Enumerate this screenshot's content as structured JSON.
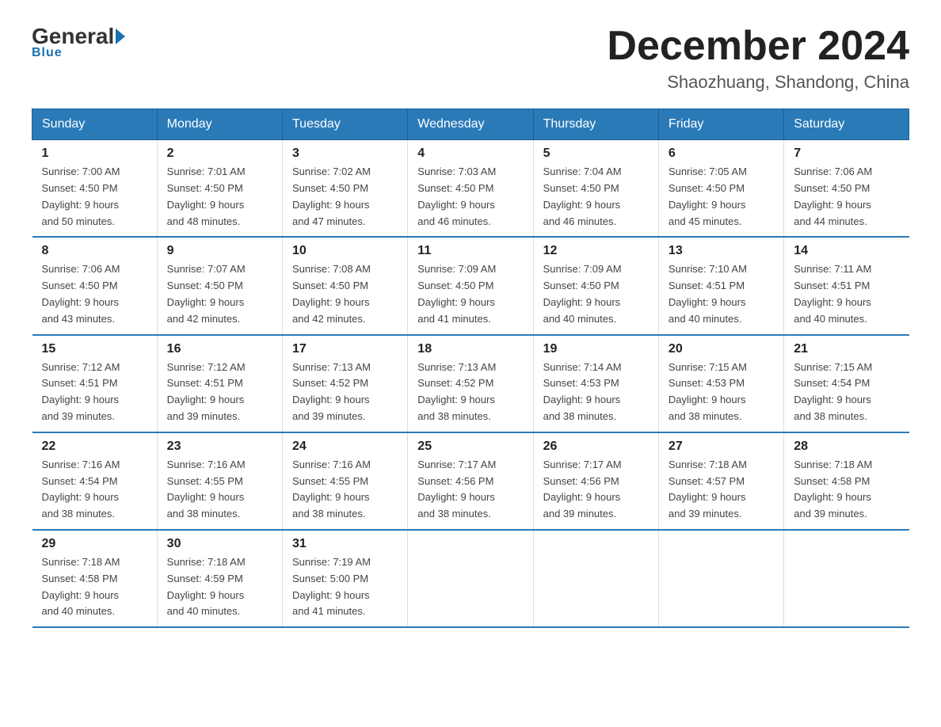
{
  "logo": {
    "general": "General",
    "blue_text": "Blue",
    "underline": "Blue"
  },
  "title": {
    "month_year": "December 2024",
    "location": "Shaozhuang, Shandong, China"
  },
  "days_of_week": [
    "Sunday",
    "Monday",
    "Tuesday",
    "Wednesday",
    "Thursday",
    "Friday",
    "Saturday"
  ],
  "weeks": [
    [
      {
        "day": "1",
        "sunrise": "7:00 AM",
        "sunset": "4:50 PM",
        "daylight": "9 hours and 50 minutes."
      },
      {
        "day": "2",
        "sunrise": "7:01 AM",
        "sunset": "4:50 PM",
        "daylight": "9 hours and 48 minutes."
      },
      {
        "day": "3",
        "sunrise": "7:02 AM",
        "sunset": "4:50 PM",
        "daylight": "9 hours and 47 minutes."
      },
      {
        "day": "4",
        "sunrise": "7:03 AM",
        "sunset": "4:50 PM",
        "daylight": "9 hours and 46 minutes."
      },
      {
        "day": "5",
        "sunrise": "7:04 AM",
        "sunset": "4:50 PM",
        "daylight": "9 hours and 46 minutes."
      },
      {
        "day": "6",
        "sunrise": "7:05 AM",
        "sunset": "4:50 PM",
        "daylight": "9 hours and 45 minutes."
      },
      {
        "day": "7",
        "sunrise": "7:06 AM",
        "sunset": "4:50 PM",
        "daylight": "9 hours and 44 minutes."
      }
    ],
    [
      {
        "day": "8",
        "sunrise": "7:06 AM",
        "sunset": "4:50 PM",
        "daylight": "9 hours and 43 minutes."
      },
      {
        "day": "9",
        "sunrise": "7:07 AM",
        "sunset": "4:50 PM",
        "daylight": "9 hours and 42 minutes."
      },
      {
        "day": "10",
        "sunrise": "7:08 AM",
        "sunset": "4:50 PM",
        "daylight": "9 hours and 42 minutes."
      },
      {
        "day": "11",
        "sunrise": "7:09 AM",
        "sunset": "4:50 PM",
        "daylight": "9 hours and 41 minutes."
      },
      {
        "day": "12",
        "sunrise": "7:09 AM",
        "sunset": "4:50 PM",
        "daylight": "9 hours and 40 minutes."
      },
      {
        "day": "13",
        "sunrise": "7:10 AM",
        "sunset": "4:51 PM",
        "daylight": "9 hours and 40 minutes."
      },
      {
        "day": "14",
        "sunrise": "7:11 AM",
        "sunset": "4:51 PM",
        "daylight": "9 hours and 40 minutes."
      }
    ],
    [
      {
        "day": "15",
        "sunrise": "7:12 AM",
        "sunset": "4:51 PM",
        "daylight": "9 hours and 39 minutes."
      },
      {
        "day": "16",
        "sunrise": "7:12 AM",
        "sunset": "4:51 PM",
        "daylight": "9 hours and 39 minutes."
      },
      {
        "day": "17",
        "sunrise": "7:13 AM",
        "sunset": "4:52 PM",
        "daylight": "9 hours and 39 minutes."
      },
      {
        "day": "18",
        "sunrise": "7:13 AM",
        "sunset": "4:52 PM",
        "daylight": "9 hours and 38 minutes."
      },
      {
        "day": "19",
        "sunrise": "7:14 AM",
        "sunset": "4:53 PM",
        "daylight": "9 hours and 38 minutes."
      },
      {
        "day": "20",
        "sunrise": "7:15 AM",
        "sunset": "4:53 PM",
        "daylight": "9 hours and 38 minutes."
      },
      {
        "day": "21",
        "sunrise": "7:15 AM",
        "sunset": "4:54 PM",
        "daylight": "9 hours and 38 minutes."
      }
    ],
    [
      {
        "day": "22",
        "sunrise": "7:16 AM",
        "sunset": "4:54 PM",
        "daylight": "9 hours and 38 minutes."
      },
      {
        "day": "23",
        "sunrise": "7:16 AM",
        "sunset": "4:55 PM",
        "daylight": "9 hours and 38 minutes."
      },
      {
        "day": "24",
        "sunrise": "7:16 AM",
        "sunset": "4:55 PM",
        "daylight": "9 hours and 38 minutes."
      },
      {
        "day": "25",
        "sunrise": "7:17 AM",
        "sunset": "4:56 PM",
        "daylight": "9 hours and 38 minutes."
      },
      {
        "day": "26",
        "sunrise": "7:17 AM",
        "sunset": "4:56 PM",
        "daylight": "9 hours and 39 minutes."
      },
      {
        "day": "27",
        "sunrise": "7:18 AM",
        "sunset": "4:57 PM",
        "daylight": "9 hours and 39 minutes."
      },
      {
        "day": "28",
        "sunrise": "7:18 AM",
        "sunset": "4:58 PM",
        "daylight": "9 hours and 39 minutes."
      }
    ],
    [
      {
        "day": "29",
        "sunrise": "7:18 AM",
        "sunset": "4:58 PM",
        "daylight": "9 hours and 40 minutes."
      },
      {
        "day": "30",
        "sunrise": "7:18 AM",
        "sunset": "4:59 PM",
        "daylight": "9 hours and 40 minutes."
      },
      {
        "day": "31",
        "sunrise": "7:19 AM",
        "sunset": "5:00 PM",
        "daylight": "9 hours and 41 minutes."
      },
      {
        "day": "",
        "sunrise": "",
        "sunset": "",
        "daylight": ""
      },
      {
        "day": "",
        "sunrise": "",
        "sunset": "",
        "daylight": ""
      },
      {
        "day": "",
        "sunrise": "",
        "sunset": "",
        "daylight": ""
      },
      {
        "day": "",
        "sunrise": "",
        "sunset": "",
        "daylight": ""
      }
    ]
  ],
  "labels": {
    "sunrise": "Sunrise:",
    "sunset": "Sunset:",
    "daylight": "Daylight:"
  }
}
